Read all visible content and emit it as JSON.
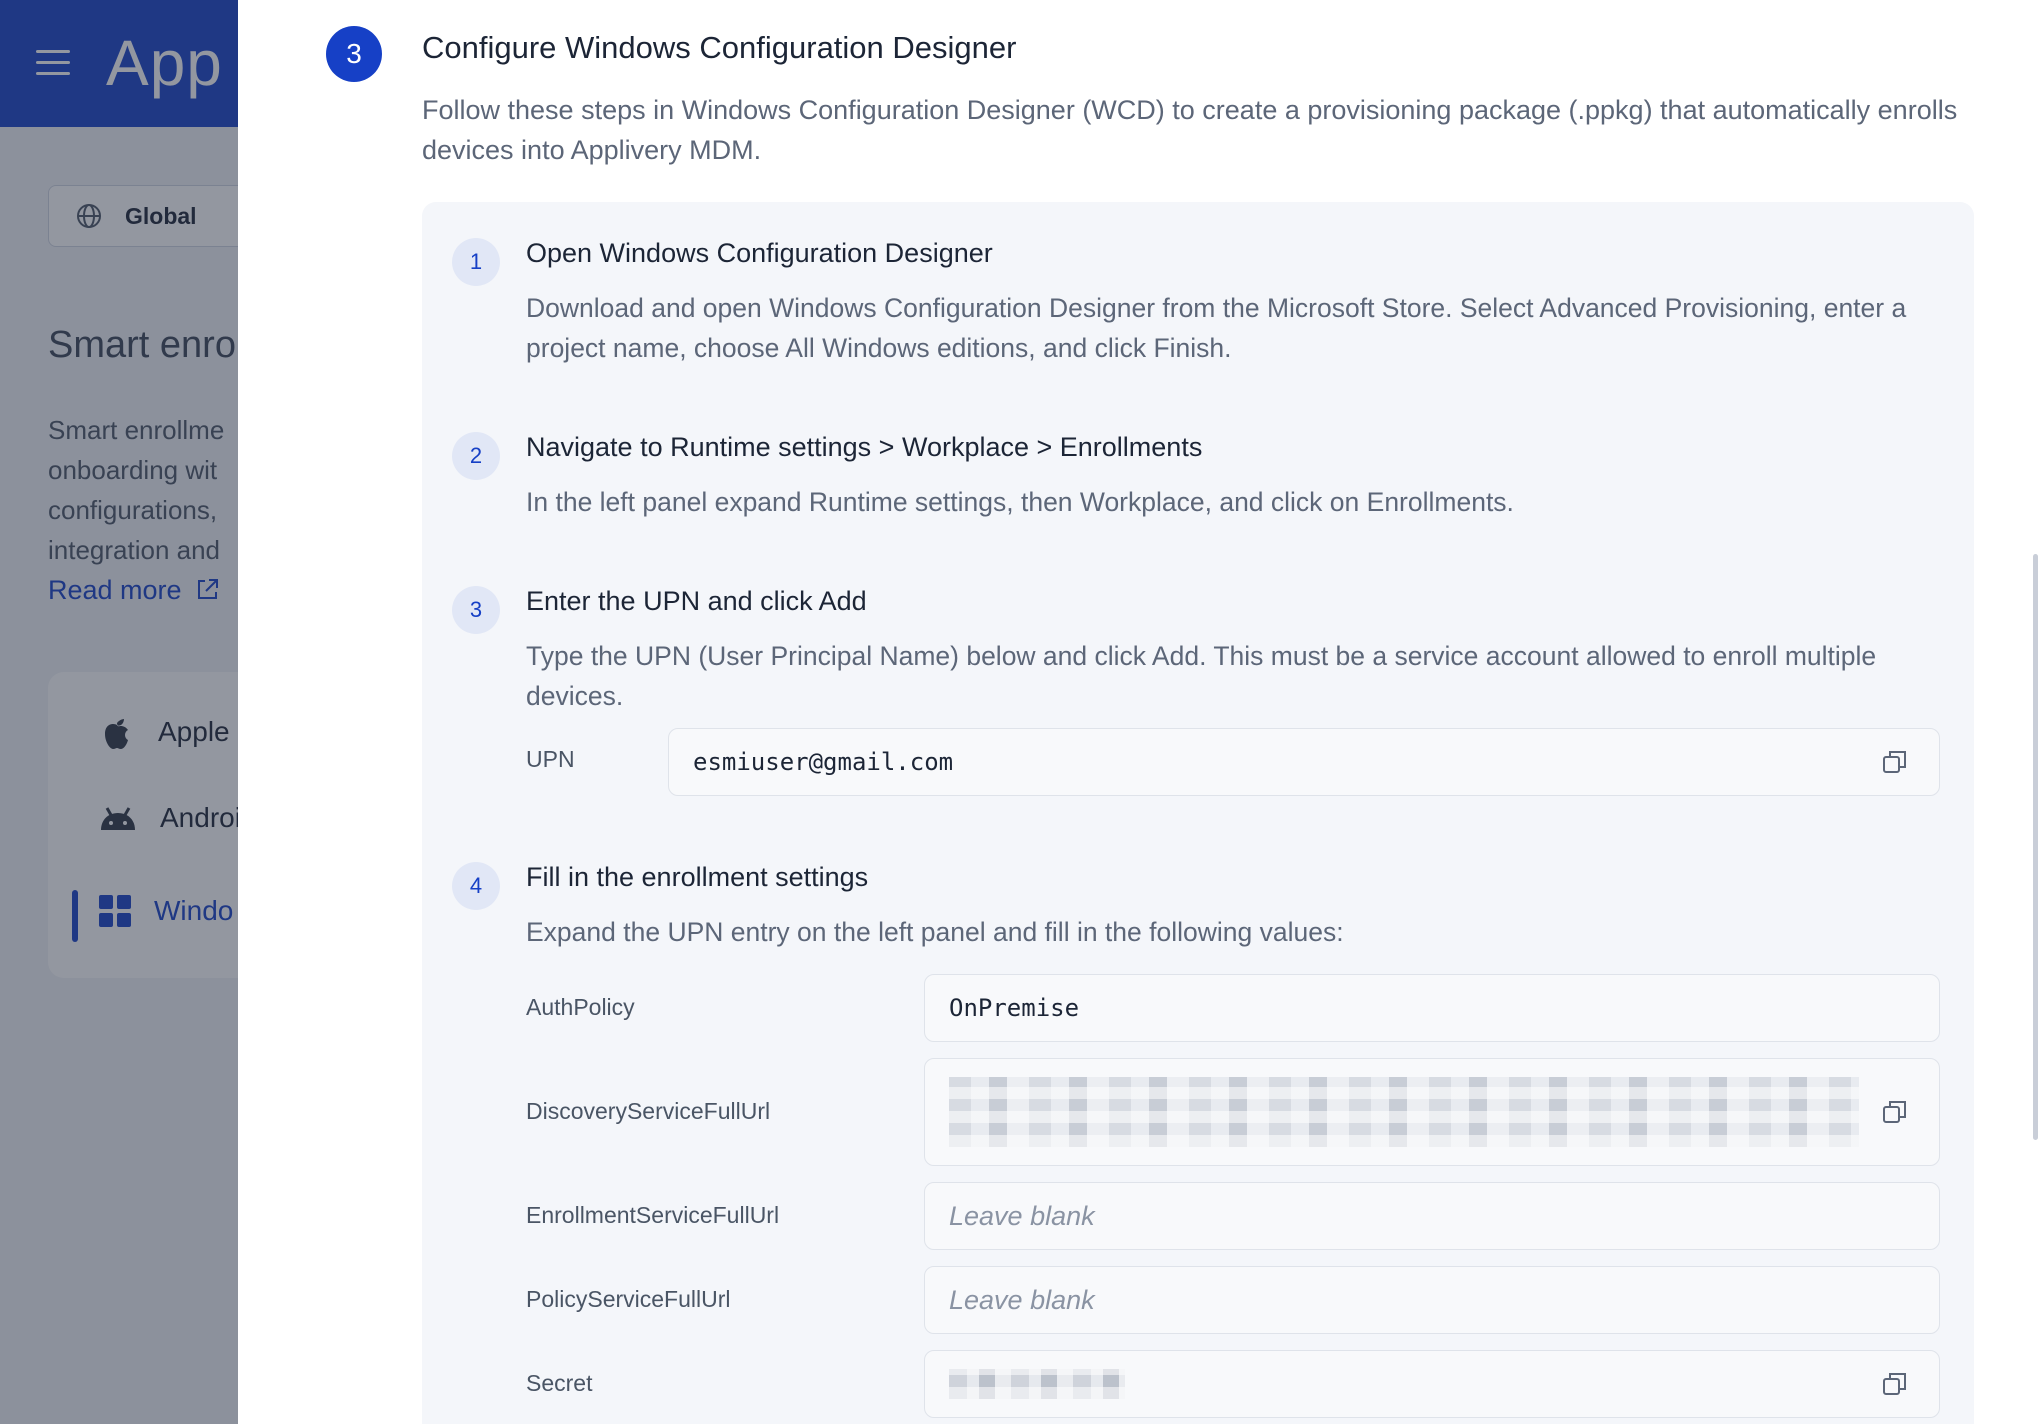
{
  "app": {
    "logo_text": "App",
    "scope_label": "Global",
    "page_title": "Smart enro",
    "description_lines": [
      "Smart enrollme",
      "onboarding wit",
      "configurations,",
      "integration and"
    ],
    "read_more": "Read more",
    "nav_items": [
      {
        "label": "Apple",
        "icon": "apple-icon"
      },
      {
        "label": "Androi",
        "icon": "android-icon"
      },
      {
        "label": "Windo",
        "icon": "windows-icon",
        "active": true
      }
    ],
    "accent_color": "#1640c6"
  },
  "drawer": {
    "step_number": "3",
    "title": "Configure Windows Configuration Designer",
    "description": "Follow these steps in Windows Configuration Designer (WCD) to create a provisioning package (.ppkg) that automatically enrolls devices into Applivery MDM.",
    "steps": [
      {
        "number": "1",
        "title": "Open Windows Configuration Designer",
        "description": "Download and open Windows Configuration Designer from the Microsoft Store. Select Advanced Provisioning, enter a project name, choose All Windows editions, and click Finish."
      },
      {
        "number": "2",
        "title": "Navigate to Runtime settings > Workplace > Enrollments",
        "description": "In the left panel expand Runtime settings, then Workplace, and click on Enrollments."
      },
      {
        "number": "3",
        "title": "Enter the UPN and click Add",
        "description": "Type the UPN (User Principal Name) below and click Add. This must be a service account allowed to enroll multiple devices.",
        "upn_label": "UPN",
        "upn_value": "esmiuser@gmail.com"
      },
      {
        "number": "4",
        "title": "Fill in the enrollment settings",
        "description": "Expand the UPN entry on the left panel and fill in the following values:",
        "fields": {
          "auth_policy": {
            "label": "AuthPolicy",
            "value": "OnPremise"
          },
          "discovery": {
            "label": "DiscoveryServiceFullUrl"
          },
          "enrollment": {
            "label": "EnrollmentServiceFullUrl",
            "placeholder": "Leave blank"
          },
          "policy": {
            "label": "PolicyServiceFullUrl",
            "placeholder": "Leave blank"
          },
          "secret": {
            "label": "Secret"
          }
        }
      }
    ]
  }
}
